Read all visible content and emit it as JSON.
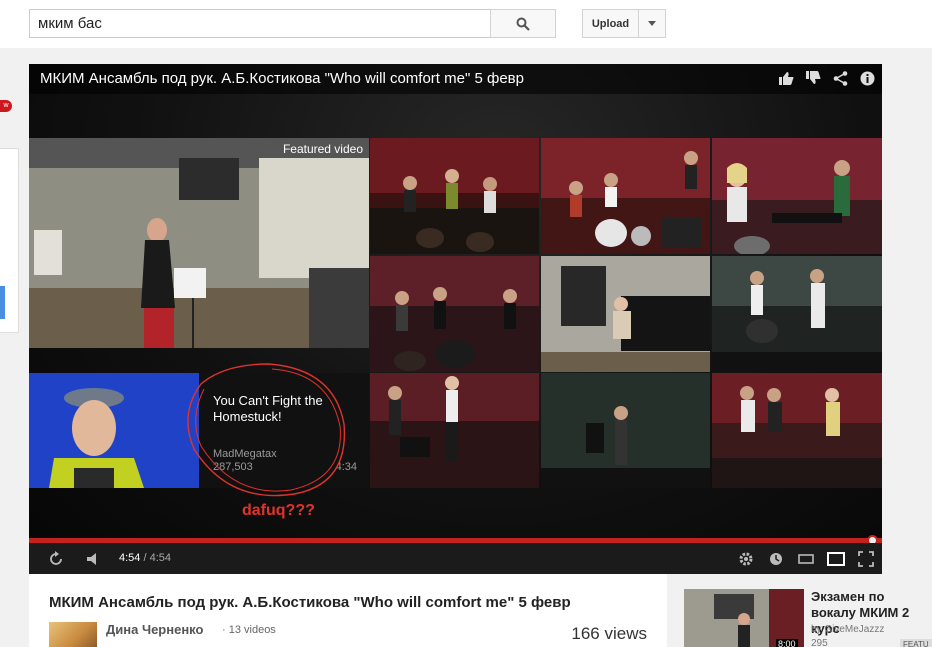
{
  "search": {
    "query": "мким бас"
  },
  "header": {
    "upload_label": "Upload"
  },
  "left_badge": "w",
  "player": {
    "title": "МКИМ Ансамбль под рук. А.Б.Костикова \"Who will comfort me\" 5 февр",
    "featured_label": "Featured video",
    "recommended": {
      "title": "You Can't Fight the Homestuck!",
      "channel": "MadMegatax",
      "views": "287,503",
      "duration": "4:34"
    },
    "annotation": "dafuq???",
    "progress_fraction": 1.0,
    "time_current": "4:54",
    "time_separator": " / ",
    "time_total": "4:54"
  },
  "below": {
    "title": "МКИМ Ансамбль под рук. А.Б.Костикова \"Who will comfort me\" 5 февр",
    "channel": "Дина Черненко",
    "video_count": "· 13 videos",
    "views": "166 views"
  },
  "sidebar": {
    "items": [
      {
        "title": "Экзамен по вокалу МКИМ 2 курс",
        "by": "by GiveMeJazzz",
        "views": "295",
        "duration": "8:00",
        "badge": "FEATU"
      }
    ]
  },
  "colors": {
    "accent": "#cc181e",
    "annotation": "#e0332c",
    "progress": "#c5221f"
  },
  "icons": [
    "search-icon",
    "chevron-down-icon",
    "thumbs-up-icon",
    "thumbs-down-icon",
    "share-icon",
    "info-icon",
    "replay-icon",
    "volume-icon",
    "settings-icon",
    "watch-later-icon",
    "small-player-icon",
    "theater-icon",
    "fullscreen-icon"
  ]
}
